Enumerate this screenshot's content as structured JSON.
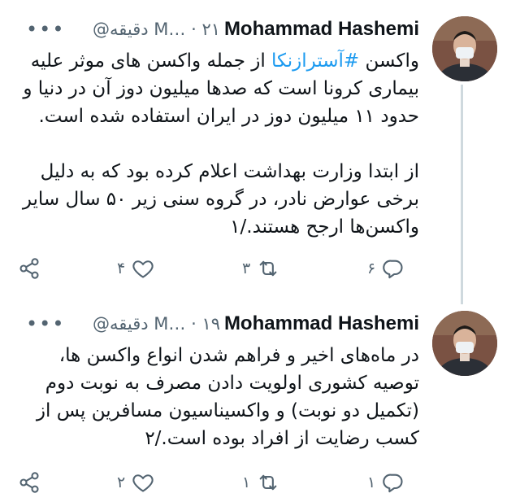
{
  "tweets": [
    {
      "author": "Mohammad Hashemi",
      "meta": "M… · ۲۱ دقیقه@",
      "more": "•••",
      "paragraphs": [
        {
          "before": "واکسن ",
          "hashtag": "#آسترازنکا",
          "after": " از جمله واکسن های موثر علیه بیماری کرونا است که صدها میلیون دوز آن در دنیا و حدود ۱۱ میلیون دوز در ایران استفاده شده است."
        },
        {
          "before": "",
          "hashtag": "",
          "after": "از ابتدا وزارت بهداشت اعلام کرده بود که به دلیل برخی عوارض نادر، در گروه سنی زیر ۵۰ سال سایر واکسن‌ها ارجح هستند./۱"
        }
      ],
      "counts": {
        "reply": "۶",
        "retweet": "۳",
        "like": "۴"
      },
      "icons": {
        "reply": "reply-icon",
        "retweet": "retweet-icon",
        "like": "heart-icon",
        "share": "share-icon"
      }
    },
    {
      "author": "Mohammad Hashemi",
      "meta": "M… · ۱۹ دقیقه@",
      "more": "•••",
      "paragraphs": [
        {
          "before": "",
          "hashtag": "",
          "after": "در ماه‌های اخیر و فراهم شدن انواع واکسن ها، توصیه کشوری اولویت دادن مصرف به نوبت دوم (تکمیل دو نوبت) و واکسیناسیون مسافرین پس از کسب رضایت از افراد بوده است./۲"
        }
      ],
      "counts": {
        "reply": "۱",
        "retweet": "۱",
        "like": "۲"
      },
      "icons": {
        "reply": "reply-icon",
        "retweet": "retweet-icon",
        "like": "heart-icon",
        "share": "share-icon"
      }
    }
  ],
  "colors": {
    "text": "#0f1419",
    "secondary": "#536471",
    "link": "#1d9bf0",
    "thread_line": "#cfd9de"
  }
}
